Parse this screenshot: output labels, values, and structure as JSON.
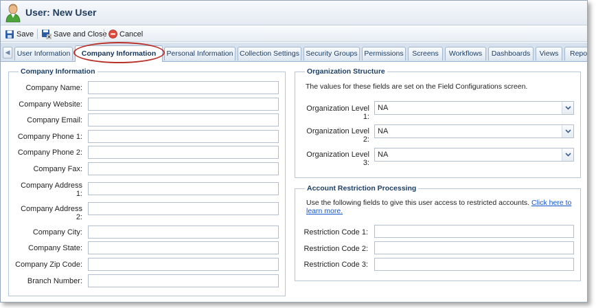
{
  "window": {
    "title": "User: New User"
  },
  "toolbar": {
    "save": "Save",
    "save_close": "Save and Close",
    "cancel": "Cancel"
  },
  "tabs": [
    "User Information",
    "Company Information",
    "Personal Information",
    "Collection Settings",
    "Security Groups",
    "Permissions",
    "Screens",
    "Workflows",
    "Dashboards",
    "Views",
    "Repor"
  ],
  "active_tab": "Company Information",
  "company": {
    "legend": "Company Information",
    "fields": [
      {
        "label": "Company Name:",
        "value": ""
      },
      {
        "label": "Company Website:",
        "value": ""
      },
      {
        "label": "Company Email:",
        "value": ""
      },
      {
        "label": "Company Phone 1:",
        "value": ""
      },
      {
        "label": "Company Phone 2:",
        "value": ""
      },
      {
        "label": "Company Fax:",
        "value": ""
      },
      {
        "label": "Company Address 1:",
        "value": ""
      },
      {
        "label": "Company Address 2:",
        "value": ""
      },
      {
        "label": "Company City:",
        "value": ""
      },
      {
        "label": "Company State:",
        "value": ""
      },
      {
        "label": "Company Zip Code:",
        "value": ""
      },
      {
        "label": "Branch Number:",
        "value": ""
      }
    ]
  },
  "org": {
    "legend": "Organization Structure",
    "note": "The values for these fields are set on the Field Configurations screen.",
    "levels": [
      {
        "label": "Organization Level 1:",
        "value": "NA"
      },
      {
        "label": "Organization Level 2:",
        "value": "NA"
      },
      {
        "label": "Organization Level 3:",
        "value": "NA"
      }
    ]
  },
  "restriction": {
    "legend": "Account Restriction Processing",
    "note": "Use the following fields to give this user access to restricted accounts.",
    "link": "Click here to learn more.",
    "codes": [
      {
        "label": "Restriction Code 1:",
        "value": ""
      },
      {
        "label": "Restriction Code 2:",
        "value": ""
      },
      {
        "label": "Restriction Code 3:",
        "value": ""
      }
    ]
  },
  "colors": {
    "header_text": "#1f3c5c",
    "legend_text": "#1c3f66",
    "highlight": "#b8322a",
    "link": "#1155cc"
  }
}
